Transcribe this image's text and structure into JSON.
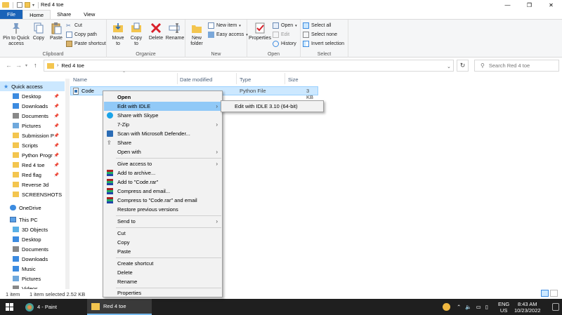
{
  "window": {
    "title": "Red 4 toe",
    "controls": {
      "minimize": "—",
      "maximize": "❐",
      "close": "✕"
    }
  },
  "ribbon_tabs": [
    "File",
    "Home",
    "Share",
    "View"
  ],
  "ribbon": {
    "clipboard": {
      "label": "Clipboard",
      "pin_label": "Pin to Quick access",
      "copy_label": "Copy",
      "paste_label": "Paste",
      "cut_label": "Cut",
      "copy_path_label": "Copy path",
      "paste_shortcut_label": "Paste shortcut"
    },
    "organize": {
      "label": "Organize",
      "move_to_label": "Move to",
      "copy_to_label": "Copy to",
      "delete_label": "Delete",
      "rename_label": "Rename"
    },
    "new": {
      "label": "New",
      "new_folder_label": "New folder",
      "new_item_label": "New item",
      "easy_access_label": "Easy access"
    },
    "open": {
      "label": "Open",
      "properties_label": "Properties",
      "open_label": "Open",
      "edit_label": "Edit",
      "history_label": "History"
    },
    "select": {
      "label": "Select",
      "select_all_label": "Select all",
      "select_none_label": "Select none",
      "invert_label": "Invert selection"
    }
  },
  "address": {
    "path": "Red 4 toe",
    "search_placeholder": "Search Red 4 toe"
  },
  "navpane": {
    "quick_access": "Quick access",
    "items": [
      {
        "label": "Desktop",
        "pinned": true
      },
      {
        "label": "Downloads",
        "pinned": true
      },
      {
        "label": "Documents",
        "pinned": true
      },
      {
        "label": "Pictures",
        "pinned": true
      },
      {
        "label": "Submission P",
        "pinned": true
      },
      {
        "label": "Scripts",
        "pinned": true
      },
      {
        "label": "Python Progr",
        "pinned": true
      },
      {
        "label": "Red 4 toe",
        "pinned": true
      },
      {
        "label": "Red flag",
        "pinned": true
      },
      {
        "label": "Reverse 3d",
        "pinned": false
      },
      {
        "label": "SCREENSHOTS",
        "pinned": false
      }
    ],
    "onedrive": "OneDrive",
    "this_pc": "This PC",
    "pc_items": [
      "3D Objects",
      "Desktop",
      "Documents",
      "Downloads",
      "Music",
      "Pictures",
      "Videos"
    ]
  },
  "columns": {
    "name": "Name",
    "date_modified": "Date modified",
    "type": "Type",
    "size": "Size"
  },
  "files": [
    {
      "name": "Code",
      "type": "Python File",
      "size": "3 KB"
    }
  ],
  "status": {
    "count": "1 item",
    "selected": "1 item selected  2.52 KB"
  },
  "context_menu": {
    "items": [
      "Open",
      "Edit with IDLE",
      "Share with Skype",
      "7-Zip",
      "Scan with Microsoft Defender...",
      "Share",
      "Open with",
      "Give access to",
      "Add to archive...",
      "Add to \"Code.rar\"",
      "Compress and email...",
      "Compress to \"Code.rar\" and email",
      "Restore previous versions",
      "Send to",
      "Cut",
      "Copy",
      "Paste",
      "Create shortcut",
      "Delete",
      "Rename",
      "Properties"
    ]
  },
  "submenu": {
    "item": "Edit with IDLE 3.10 (64-bit)"
  },
  "taskbar": {
    "paint": "4 - Paint",
    "explorer": "Red 4 toe",
    "lang": "ENG",
    "region": "US",
    "time": "8:43 AM",
    "date": "10/23/2022"
  },
  "colors": {
    "accent": "#1a63b8",
    "selection": "#cce8ff",
    "menu_highlight": "#91c9f7",
    "taskbar": "#1f1f1f"
  }
}
